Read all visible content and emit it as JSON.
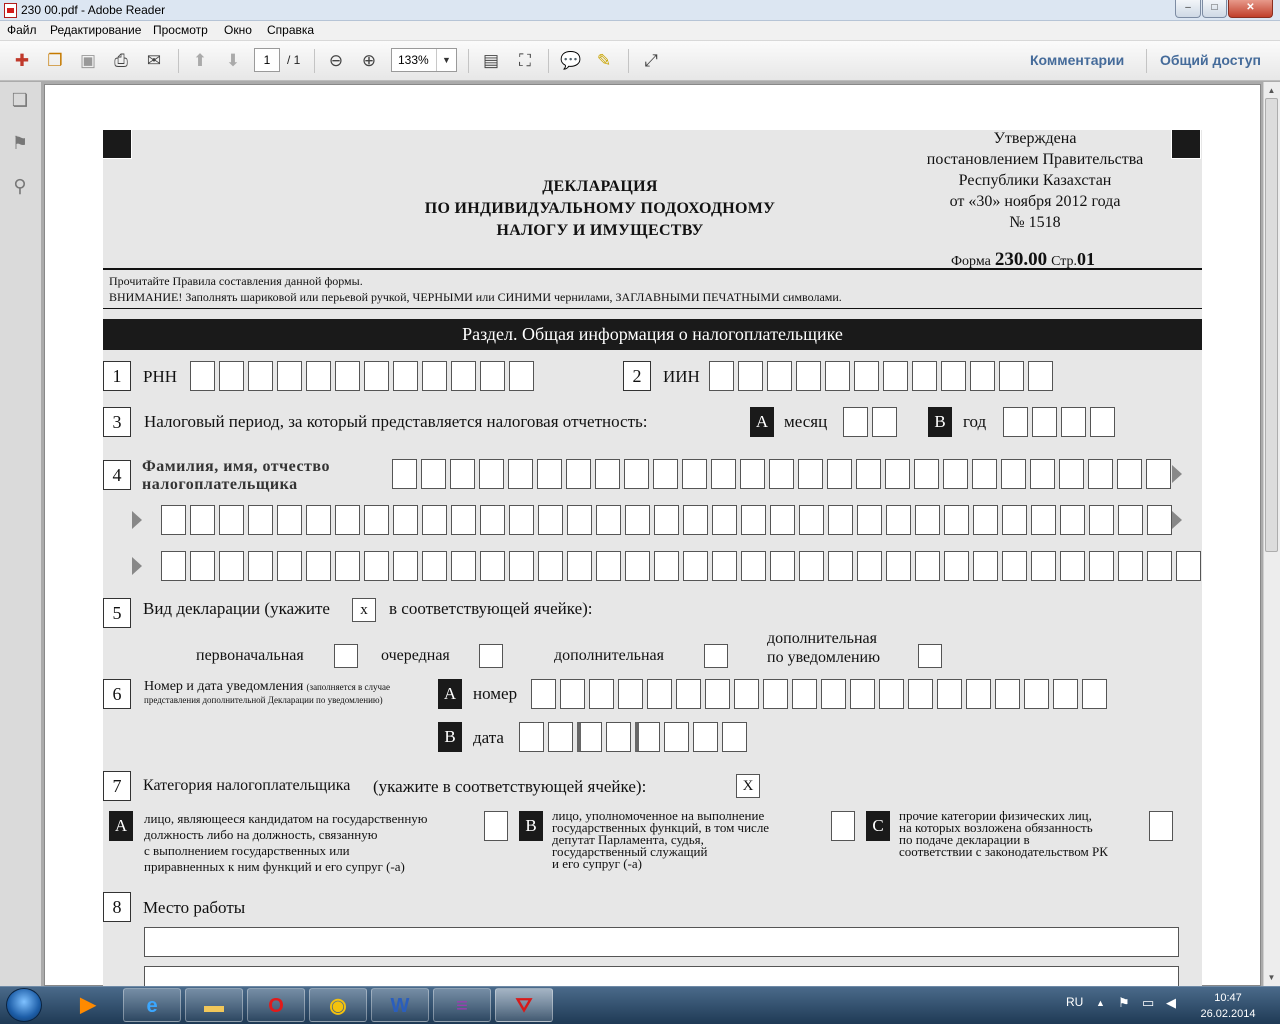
{
  "window": {
    "title": "230 00.pdf - Adobe Reader",
    "minimize": "–",
    "maximize": "□",
    "close": "✕"
  },
  "menu": [
    "Файл",
    "Редактирование",
    "Просмотр",
    "Окно",
    "Справка"
  ],
  "toolbar": {
    "page_current": "1",
    "page_total": "/ 1",
    "zoom": "133%",
    "comments_link": "Комментарии",
    "share_link": "Общий доступ"
  },
  "form": {
    "approved": [
      "Утверждена",
      "постановлением Правительства",
      "Республики Казахстан",
      "от «30» ноября 2012 года",
      "№ 1518"
    ],
    "title": [
      "ДЕКЛАРАЦИЯ",
      "ПО ИНДИВИДУАЛЬНОМУ ПОДОХОДНОМУ",
      "НАЛОГУ И ИМУЩЕСТВУ"
    ],
    "form_label": "Форма",
    "form_number": "230.00",
    "page_label": "Стр.",
    "page_number": "01",
    "note1": "Прочитайте Правила составления данной формы.",
    "note2": "ВНИМАНИЕ! Заполнять шариковой или перьевой ручкой, ЧЕРНЫМИ или СИНИМИ чернилами, ЗАГЛАВНЫМИ ПЕЧАТНЫМИ символами.",
    "section_title": "Раздел. Общая информация о налогоплательщике",
    "f1": {
      "num": "1",
      "label": "РНН"
    },
    "f2": {
      "num": "2",
      "label": "ИИН"
    },
    "f3": {
      "num": "3",
      "label": "Налоговый период, за который представляется налоговая отчетность:",
      "a": "A",
      "a_label": "месяц",
      "b": "B",
      "b_label": "год"
    },
    "f4": {
      "num": "4",
      "label1": "Фамилия,  имя, отчество",
      "label2": "налогоплательщика"
    },
    "f5": {
      "num": "5",
      "label": "Вид декларации (укажите",
      "mark": "х",
      "label_tail": "в соответствующей ячейке):",
      "opt1": "первоначальная",
      "opt2": "очередная",
      "opt3": "дополнительная",
      "opt4a": "дополнительная",
      "opt4b": "по уведомлению"
    },
    "f6": {
      "num": "6",
      "label": "Номер и дата уведомления",
      "note1": "(заполняется в случае",
      "note2": "представления дополнительной Декларации по уведомлению)",
      "a": "A",
      "a_label": "номер",
      "b": "B",
      "b_label": "дата"
    },
    "f7": {
      "num": "7",
      "label": "Категория налогоплательщика",
      "label2": "(укажите в соответствующей ячейке):",
      "mark": "Х",
      "a": "A",
      "a_text": [
        "лицо, являющееся кандидатом на государственную",
        "должность либо на должность, связанную",
        "с выполнением государственных или",
        "приравненных к ним функций и его супруг (-а)"
      ],
      "b": "B",
      "b_text": [
        "лицо, уполномоченное на выполнение",
        "государственных функций, в том числе",
        "депутат Парламента, судья,",
        "государственный служащий",
        "и его супруг (-а)"
      ],
      "c": "C",
      "c_text": [
        "прочие категории физических лиц,",
        "на которых возложена обязанность",
        "по подаче декларации в",
        "соответствии с законодательством РК"
      ]
    },
    "f8": {
      "num": "8",
      "label": "Место работы"
    }
  },
  "taskbar": {
    "lang": "RU",
    "time": "10:47",
    "date": "26.02.2014"
  }
}
